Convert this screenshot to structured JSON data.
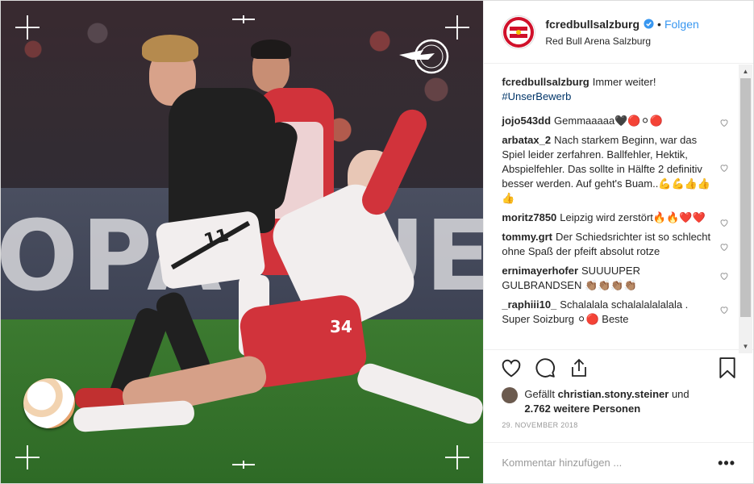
{
  "post": {
    "image_alt": "Fußballszene: Spieler im schwarzen Trikot und Spieler im rot-weißen Trikot im Zweikampf um den Ball",
    "banner_left": "OPA",
    "banner_right": "UE",
    "shirt_number_dark": "11",
    "shirt_number_red": "34"
  },
  "header": {
    "username": "fcredbullsalzburg",
    "separator": "•",
    "follow_label": "Folgen",
    "location": "Red Bull Arena Salzburg"
  },
  "caption": {
    "username": "fcredbullsalzburg",
    "text": "Immer weiter!",
    "hashtag": "#UnserBewerb"
  },
  "comments": [
    {
      "user": "jojo543dd",
      "text": "Gemmaaaaa🖤🔴⚪🔴"
    },
    {
      "user": "arbatax_2",
      "text": "Nach starkem Beginn, war das Spiel leider zerfahren. Ballfehler, Hektik, Abspielfehler. Das sollte in Hälfte 2 definitiv besser werden. Auf geht's Buam..💪💪👍👍👍"
    },
    {
      "user": "moritz7850",
      "text": "Leipzig wird zerstört🔥🔥❤️❤️"
    },
    {
      "user": "tommy.grt",
      "text": "Der Schiedsrichter ist so schlecht ohne Spaß der pfeift absolut rotze"
    },
    {
      "user": "ernimayerhofer",
      "text": "SUUUUPER GULBRANDSEN 👏🏽👏🏽👏🏽👏🏽"
    },
    {
      "user": "_raphiii10_",
      "text": "Schalalala schalalalalalala . Super Soizburg ⚪🔴 Beste"
    }
  ],
  "likes": {
    "prefix": "Gefällt",
    "user": "christian.stony.steiner",
    "connector": "und",
    "count": "2.762 weitere Personen"
  },
  "date": "29. NOVEMBER 2018",
  "add_comment": {
    "placeholder": "Kommentar hinzufügen ...",
    "more": "•••"
  },
  "colors": {
    "link": "#3897f0",
    "hashtag": "#003569",
    "verified": "#3897f0",
    "salzburg_red": "#d0102a"
  }
}
